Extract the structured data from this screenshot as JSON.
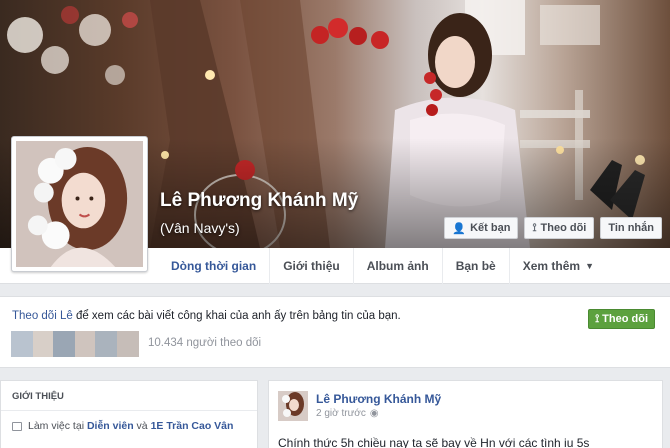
{
  "profile": {
    "name": "Lê Phương Khánh Mỹ",
    "alternate_name": "(Vân Navy's)"
  },
  "cover_actions": [
    {
      "label": "Kết bạn",
      "icon": "add-friend-icon",
      "glyph": "👤"
    },
    {
      "label": "Theo dõi",
      "icon": "rss-icon",
      "glyph": "⟟"
    },
    {
      "label": "Tin nhắn",
      "icon": "",
      "glyph": ""
    }
  ],
  "nav_tabs": [
    {
      "label": "Dòng thời gian",
      "has_caret": false
    },
    {
      "label": "Giới thiệu",
      "has_caret": false
    },
    {
      "label": "Album ảnh",
      "has_caret": false
    },
    {
      "label": "Bạn bè",
      "has_caret": false
    },
    {
      "label": "Xem thêm",
      "has_caret": true
    }
  ],
  "follow_box": {
    "link_text": "Theo dõi Lê",
    "rest_text": " để xem các bài viết công khai của anh ấy trên bảng tin của bạn.",
    "button_label": "Theo dõi",
    "follower_count": "10.434 người theo dõi"
  },
  "intro": {
    "title": "Giới thiệu",
    "work_prefix": "Làm việc tại ",
    "work_place_1": "Diễn viên",
    "work_joiner": " và ",
    "work_place_2": "1E Trần Cao Vân"
  },
  "post": {
    "author": "Lê Phương Khánh Mỹ",
    "time": "2 giờ trước",
    "text": "Chính thức 5h chiều nay ta sẽ bay về Hn với các tình iu 5s"
  },
  "colors": {
    "link": "#365899",
    "follow_green": "#5ca13e",
    "page_bg": "#e9ebee"
  }
}
